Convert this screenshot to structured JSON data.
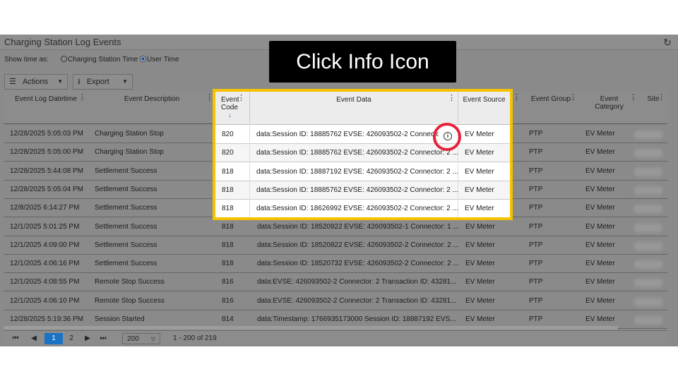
{
  "window": {
    "title": "Charging Station Log Events",
    "refresh_icon": "refresh-icon"
  },
  "show_time": {
    "label": "Show time as:",
    "options": [
      "Charging Station Time",
      "User Time"
    ],
    "selected": "User Time"
  },
  "toolbar": {
    "actions_label": "Actions",
    "export_label": "Export"
  },
  "columns": [
    "Event Log Datetime",
    "Event Description",
    "Event Code",
    "Event Data",
    "Event Source",
    "Event Group",
    "Event Category",
    "Site"
  ],
  "sort": {
    "column": "Event Code",
    "direction": "↓"
  },
  "rows": [
    [
      "12/28/2025 5:05:03 PM",
      "Charging Station Stop",
      "820",
      "data:Session ID: 18885762 EVSE: 426093502-2 Connector: 2 ...",
      "EV Meter",
      "PTP",
      "EV Meter"
    ],
    [
      "12/28/2025 5:05:00 PM",
      "Charging Station Stop",
      "820",
      "data:Session ID: 18885762 EVSE: 426093502-2 Connector: 2 ...",
      "EV Meter",
      "PTP",
      "EV Meter"
    ],
    [
      "12/28/2025 5:44:08 PM",
      "Settlement Success",
      "818",
      "data:Session ID: 18887192 EVSE: 426093502-2 Connector: 2 ...",
      "EV Meter",
      "PTP",
      "EV Meter"
    ],
    [
      "12/28/2025 5:05:04 PM",
      "Settlement Success",
      "818",
      "data:Session ID: 18885762 EVSE: 426093502-2 Connector: 2 ...",
      "EV Meter",
      "PTP",
      "EV Meter"
    ],
    [
      "12/8/2025 6:14:27 PM",
      "Settlement Success",
      "818",
      "data:Session ID: 18626992 EVSE: 426093502-2 Connector: 2 ...",
      "EV Meter",
      "PTP",
      "EV Meter"
    ],
    [
      "12/1/2025 5:01:25 PM",
      "Settlement Success",
      "818",
      "data:Session ID: 18520922 EVSE: 426093502-1 Connector: 1 ...",
      "EV Meter",
      "PTP",
      "EV Meter"
    ],
    [
      "12/1/2025 4:09:00 PM",
      "Settlement Success",
      "818",
      "data:Session ID: 18520822 EVSE: 426093502-2 Connector: 2 ...",
      "EV Meter",
      "PTP",
      "EV Meter"
    ],
    [
      "12/1/2025 4:06:16 PM",
      "Settlement Success",
      "818",
      "data:Session ID: 18520732 EVSE: 426093502-2 Connector: 2 ...",
      "EV Meter",
      "PTP",
      "EV Meter"
    ],
    [
      "12/1/2025 4:08:55 PM",
      "Remote Stop Success",
      "816",
      "data:EVSE: 426093502-2 Connector: 2 Transaction ID: 43281...",
      "EV Meter",
      "PTP",
      "EV Meter"
    ],
    [
      "12/1/2025 4:06:10 PM",
      "Remote Stop Success",
      "816",
      "data:EVSE: 426093502-2 Connector: 2 Transaction ID: 43281...",
      "EV Meter",
      "PTP",
      "EV Meter"
    ],
    [
      "12/28/2025 5:19:36 PM",
      "Session Started",
      "814",
      "data:Timestamp: 1766935173000 Session ID: 18887192 EVS...",
      "EV Meter",
      "PTP",
      "EV Meter"
    ]
  ],
  "pager": {
    "pages": [
      "1",
      "2"
    ],
    "current": "1",
    "page_size": "200",
    "summary": "1 - 200 of 219"
  },
  "callout": {
    "text": "Click Info Icon",
    "info_glyph": "i"
  },
  "colors": {
    "highlight": "#f5c200",
    "circle": "#e8213a",
    "selected_page": "#1a73c4"
  }
}
